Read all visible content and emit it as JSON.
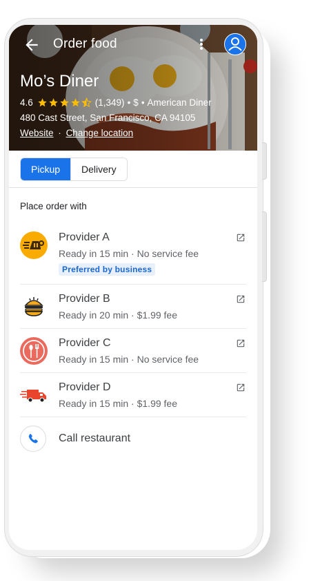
{
  "header": {
    "title": "Order food",
    "back_icon": "arrow-back-icon",
    "more_icon": "more-vert-icon",
    "account_icon": "account-circle-icon"
  },
  "restaurant": {
    "name": "Mo’s Diner",
    "rating": "4.6",
    "stars": 4.5,
    "review_count": "(1,349)",
    "separator1": "•",
    "price": "$",
    "separator2": "•",
    "category": "American Diner",
    "address": "480 Cast Street, San Francisco, CA 94105",
    "website_label": "Website",
    "links_separator": "·",
    "change_location_label": "Change location"
  },
  "mode_toggle": {
    "pickup_label": "Pickup",
    "delivery_label": "Delivery",
    "selected": "Pickup"
  },
  "section_label": "Place order with",
  "providers": [
    {
      "name": "Provider A",
      "detail": "Ready in 15 min · No service fee",
      "badge": "Preferred by business",
      "icon": "fast-food-icon"
    },
    {
      "name": "Provider B",
      "detail": "Ready in 20 min · $1.99 fee",
      "icon": "burger-icon"
    },
    {
      "name": "Provider C",
      "detail": "Ready in 15 min · No service fee",
      "icon": "fork-spoon-icon"
    },
    {
      "name": "Provider D",
      "detail": "Ready in 15 min · $1.99 fee",
      "icon": "delivery-truck-icon"
    }
  ],
  "call": {
    "label": "Call restaurant",
    "icon": "phone-icon"
  },
  "colors": {
    "accent": "#1a73e8",
    "star": "#fbbc04",
    "provider_a": "#f9ab00",
    "provider_c": "#ea6b5e",
    "provider_d": "#e8452c"
  }
}
